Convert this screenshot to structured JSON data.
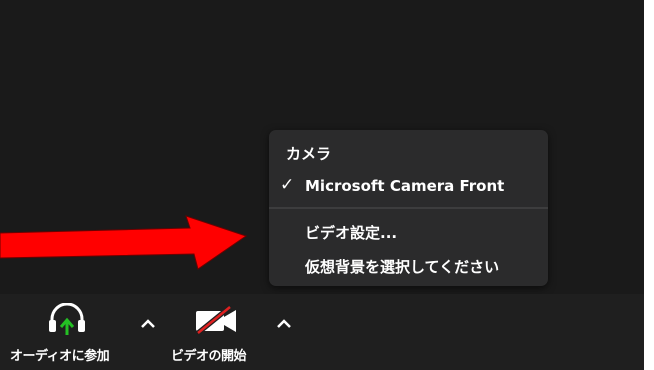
{
  "colors": {
    "background": "#1a1a1a",
    "toolbar": "#1f1f1f",
    "menu": "#2b2b2c",
    "arrow": "#ff0000",
    "audio_arrow": "#24c024",
    "video_slash": "#e02020"
  },
  "camera_menu": {
    "header": "カメラ",
    "selected_check": "✓",
    "selected_camera": "Microsoft Camera Front",
    "video_settings": "ビデオ設定...",
    "virtual_background": "仮想背景を選択してください"
  },
  "toolbar": {
    "audio_label": "オーディオに参加",
    "audio_icon": "headphones-icon",
    "video_label": "ビデオの開始",
    "video_icon": "video-off-icon",
    "caret_icon": "chevron-up-icon"
  },
  "annotation": {
    "icon": "red-arrow-icon"
  }
}
